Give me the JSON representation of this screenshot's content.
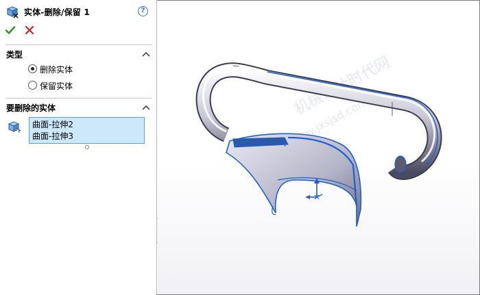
{
  "window": {
    "title": "实体-删除/保留 1"
  },
  "toolbar": {
    "help_label": "?"
  },
  "sections": {
    "type": {
      "title": "类型",
      "options": [
        {
          "label": "删除实体",
          "selected": true
        },
        {
          "label": "保留实体",
          "selected": false
        }
      ]
    },
    "bodies": {
      "title": "要删除的实体",
      "items": [
        "曲面-拉伸2",
        "曲面-拉伸3"
      ]
    }
  },
  "viewport": {
    "watermark_line1": "机械设计时代网",
    "watermark_line2": "www.jxsjsd.com"
  },
  "colors": {
    "accent_blue": "#3b6fc4",
    "selection_fill": "#cde8fb",
    "ok_green": "#2d9a2d",
    "cancel_red": "#d21f1f",
    "edge_blue": "#1e5fd0"
  }
}
